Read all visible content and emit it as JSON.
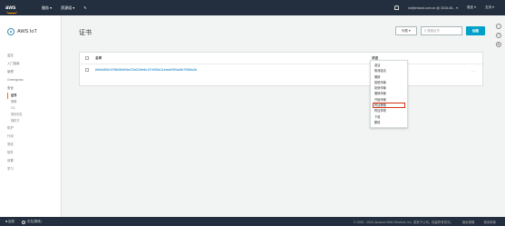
{
  "topbar": {
    "logo": "aws",
    "menu": [
      "服务 ▾",
      "资源组 ▾",
      "✎"
    ],
    "account": "iot@ehand.com.cn @ 3316-06... ▾",
    "region": "俄亥 ▾",
    "support": "支持 ▾"
  },
  "sidebar": {
    "brand": "AWS IoT",
    "items": [
      {
        "label": "监控",
        "type": "item"
      },
      {
        "label": "入门指南",
        "type": "item"
      },
      {
        "label": "管理",
        "type": "item"
      },
      {
        "label": "Greengrass",
        "type": "item"
      },
      {
        "label": "安全",
        "type": "section"
      }
    ],
    "security_sub": [
      "证书",
      "策略",
      "CA",
      "角色别名",
      "授权方"
    ],
    "more_items": [
      "防护",
      "行动",
      "测试",
      "软件",
      "设置",
      "学习"
    ]
  },
  "main": {
    "title": "证书",
    "actions_label": "列表 ▾",
    "search_placeholder": "搜索证书",
    "create_label": "创建",
    "table": {
      "headers": [
        "名称",
        "状态"
      ],
      "rows": [
        {
          "name": "8b5cb85b167f8fd5fdb9ba72e634fef4e157b953c11ebea09f0ad0b7958bc2b",
          "status": "活跃",
          "menu": "…"
        }
      ]
    },
    "dropdown": {
      "items": [
        "激活",
        "取消激活",
        "撤销",
        "接受传输",
        "拒绝传输",
        "撤销传输",
        "开始传输",
        "附加策略",
        "附加事物",
        "下载",
        "删除"
      ],
      "highlighted_index": 7
    }
  },
  "footer": {
    "feedback": "反馈",
    "language": "中文(简体)",
    "copyright": "© 2008 - 2018, Amazon Web Services, Inc. 或其子公司。保留所有权利。",
    "privacy": "隐私策略",
    "terms": "使用条款"
  }
}
